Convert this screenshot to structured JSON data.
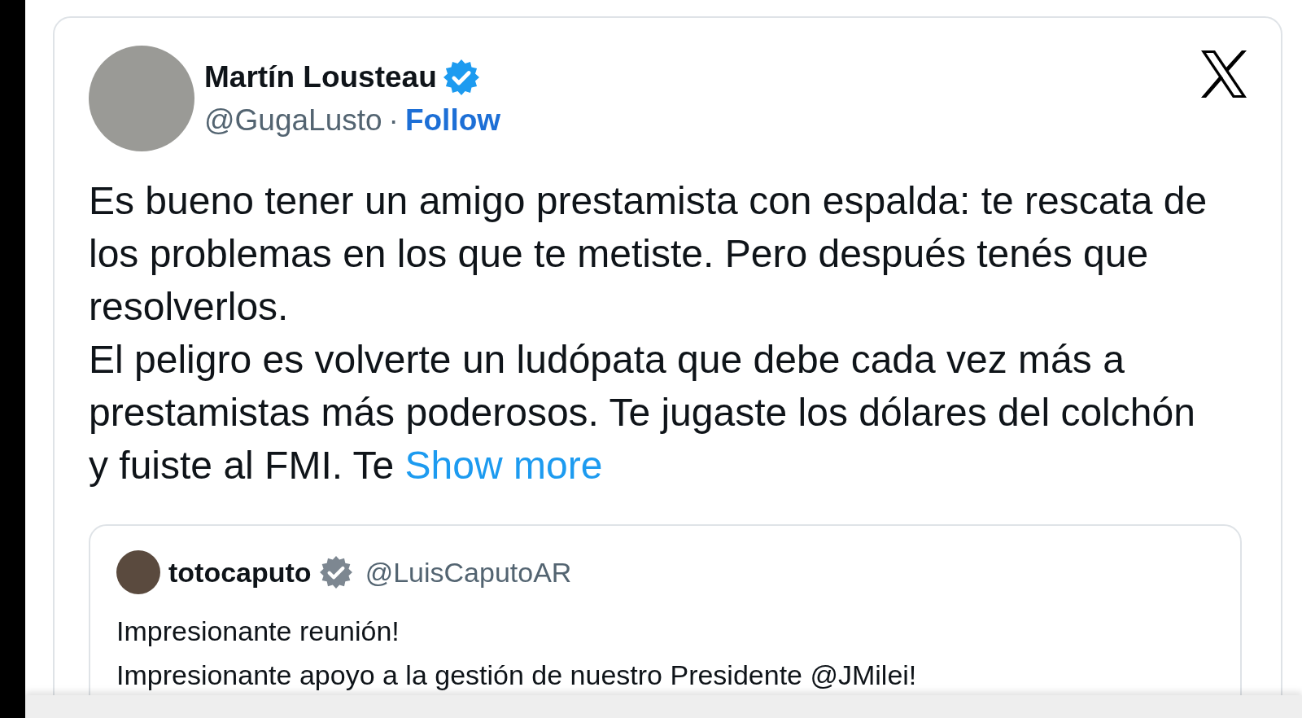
{
  "tweet": {
    "author": {
      "name": "Martín Lousteau",
      "verified": true,
      "handle": "@GugaLusto",
      "separator": "·",
      "follow": "Follow"
    },
    "paragraphs": [
      "Es bueno tener un amigo prestamista con espalda: te rescata de los problemas en los que te metiste. Pero después tenés que resolverlos.",
      "El peligro es volverte un ludópata que debe cada vez más a prestamistas más poderosos. Te jugaste los dólares del colchón y fuiste al FMI. Te"
    ],
    "show_more": "Show more",
    "quote": {
      "author": {
        "name": "totocaputo",
        "verified": true,
        "handle": "@LuisCaputoAR"
      },
      "lines": [
        "Impresionante reunión!",
        "Impresionante apoyo a la gestión de nuestro Presidente @JMilei!"
      ]
    }
  }
}
